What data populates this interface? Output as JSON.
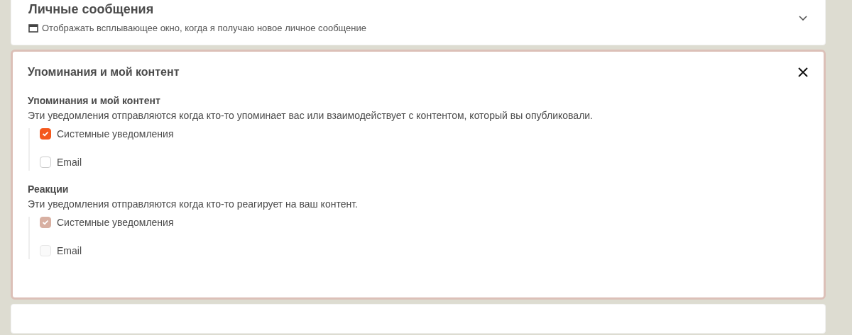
{
  "collapsed_section": {
    "title": "Личные сообщения",
    "description": "Отображать всплывающее окно, когда я получаю новое личное сообщение",
    "expanded": false
  },
  "open_section": {
    "title": "Упоминания и мой контент",
    "expanded": true,
    "groups": [
      {
        "title": "Упоминания и мой контент",
        "description": "Эти уведомления отправляются когда кто-то упоминает вас или взаимодействует с контентом, который вы опубликовали.",
        "options": [
          {
            "label": "Системные уведомления",
            "checked": true,
            "disabled": false
          },
          {
            "label": "Email",
            "checked": false,
            "disabled": false
          }
        ]
      },
      {
        "title": "Реакции",
        "description": "Эти уведомления отправляются когда кто-то реагирует на ваш контент.",
        "options": [
          {
            "label": "Системные уведомления",
            "checked": true,
            "disabled": true
          },
          {
            "label": "Email",
            "checked": false,
            "disabled": true
          }
        ]
      }
    ]
  }
}
